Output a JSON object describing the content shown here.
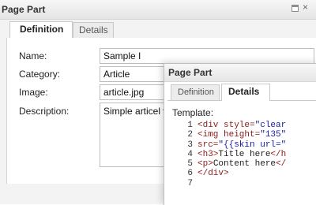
{
  "back_dialog": {
    "title": "Page Part",
    "window_buttons": {
      "maximize": "□",
      "close": "×"
    },
    "tabs": [
      {
        "label": "Definition"
      },
      {
        "label": "Details"
      }
    ],
    "fields": {
      "name": {
        "label": "Name:",
        "value": "Sample I"
      },
      "category": {
        "label": "Category:",
        "value": "Article"
      },
      "image": {
        "label": "Image:",
        "value": "article.jpg"
      },
      "description": {
        "label": "Description:",
        "value": "Simple articel w"
      }
    }
  },
  "front_dialog": {
    "title": "Page Part",
    "tabs": [
      {
        "label": "Definition"
      },
      {
        "label": "Details"
      }
    ],
    "template_label": "Template:",
    "code_lines": [
      {
        "num": "1",
        "parts": [
          {
            "t": "tag",
            "v": "<div style="
          },
          {
            "t": "str",
            "v": "\"clear"
          }
        ]
      },
      {
        "num": "2",
        "parts": [
          {
            "t": "tag",
            "v": "<img height="
          },
          {
            "t": "str",
            "v": "\"135\""
          }
        ]
      },
      {
        "num": "3",
        "parts": [
          {
            "t": "tag",
            "v": "src="
          },
          {
            "t": "str",
            "v": "\"{{skin url=\""
          }
        ]
      },
      {
        "num": "4",
        "parts": [
          {
            "t": "tag",
            "v": "<h3>"
          },
          {
            "t": "txt",
            "v": "Title here"
          },
          {
            "t": "tag",
            "v": "</h"
          }
        ]
      },
      {
        "num": "5",
        "parts": [
          {
            "t": "tag",
            "v": "<p>"
          },
          {
            "t": "txt",
            "v": "Content here"
          },
          {
            "t": "tag",
            "v": "</"
          }
        ]
      },
      {
        "num": "6",
        "parts": [
          {
            "t": "tag",
            "v": "</div>"
          }
        ]
      },
      {
        "num": "7",
        "parts": []
      }
    ]
  }
}
